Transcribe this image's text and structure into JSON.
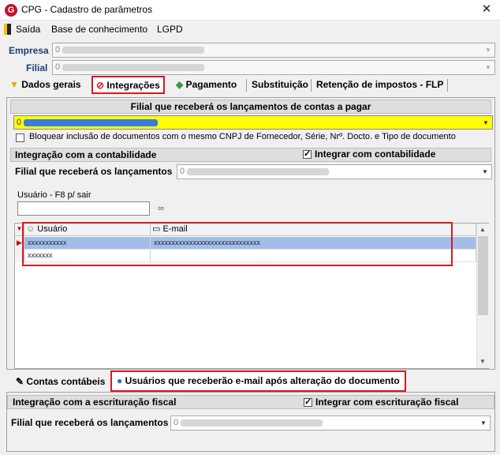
{
  "window": {
    "title": "CPG - Cadastro de parâmetros",
    "close_glyph": "✕",
    "app_icon_letter": "G"
  },
  "menu": {
    "items": [
      "Saída",
      "Base de conhecimento",
      "LGPD"
    ]
  },
  "header": {
    "empresa_label": "Empresa",
    "empresa_value_prefix": "0",
    "filial_label": "Filial",
    "filial_value_prefix": "0"
  },
  "tabs": [
    {
      "label": "Dados gerais",
      "icon": "funnel-icon"
    },
    {
      "label": "Integrações",
      "icon": "integration-icon",
      "active": true
    },
    {
      "label": "Pagamento",
      "icon": "money-icon"
    },
    {
      "label": "Substituição"
    },
    {
      "label": "Retenção de impostos - FLP"
    }
  ],
  "payables": {
    "section_title": "Filial que receberá os lançamentos de contas a pagar",
    "block_checkbox_label": "Bloquear inclusão de documentos com o mesmo CNPJ de Fornecedor, Série, Nrº. Docto. e Tipo de documento",
    "selected_value_prefix": "0"
  },
  "accounting": {
    "section_title": "Integração com a contabilidade",
    "integrate_label": "Integrar com contabilidade",
    "integrate_checked": true,
    "branch_label": "Filial que receberá os lançamentos",
    "branch_value_prefix": "0"
  },
  "user_search": {
    "label": "Usuário - F8 p/ sair",
    "value": "",
    "search_icon": "binoculars-icon"
  },
  "grid": {
    "columns": [
      "Usuário",
      "E-mail"
    ],
    "rows": [
      {
        "user": "xxxxxxxxxxx",
        "email": "xxxxxxxxxxxxxxxxxxxxxxxxxxxxxx",
        "selected": true
      },
      {
        "user": "xxxxxxx",
        "email": "",
        "selected": false
      }
    ]
  },
  "bottom_tabs": [
    {
      "label": "Contas contábeis",
      "icon": "pen-icon"
    },
    {
      "label": "Usuários que receberão e-mail após alteração do documento",
      "icon": "user-icon",
      "active": true
    }
  ],
  "fiscal": {
    "section_title": "Integração com a escrituração fiscal",
    "integrate_label": "Integrar com escrituração fiscal",
    "integrate_checked": true,
    "branch_label": "Filial que receberá os lançamentos",
    "branch_value_prefix": "0"
  },
  "colors": {
    "highlight_yellow": "#ffff00",
    "selected_row": "#a3bde8",
    "redbox": "#d7191f",
    "label_blue": "#1f3d7a"
  }
}
